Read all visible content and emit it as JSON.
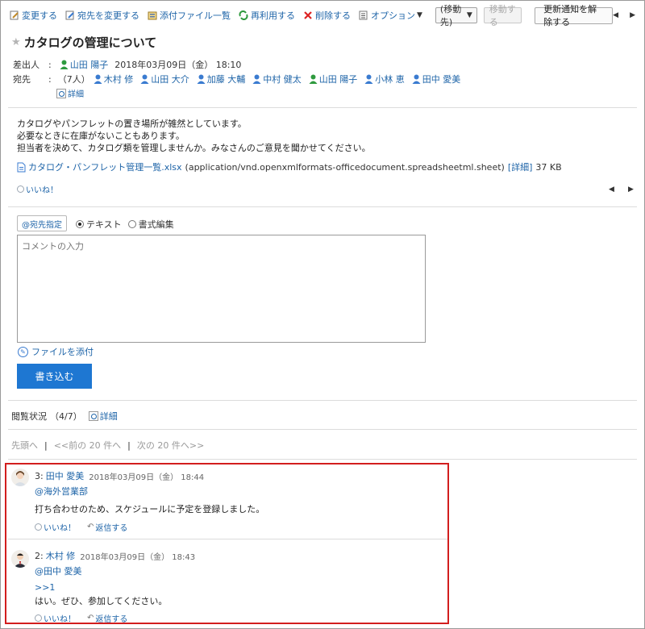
{
  "toolbar": {
    "change": "変更する",
    "change_recipients": "宛先を変更する",
    "attachments_list": "添付ファイル一覧",
    "reuse": "再利用する",
    "delete": "削除する",
    "options": "オプション",
    "move_select": "(移動先)",
    "move_button": "移動する",
    "unsubscribe": "更新通知を解除する"
  },
  "message": {
    "title": "カタログの管理について",
    "sender_label": "差出人",
    "sender_name": "山田 陽子",
    "sent_at": "2018年03月09日（金） 18:10",
    "recipients_label": "宛先",
    "recipients_count": "（7人）",
    "recipients": [
      "木村 修",
      "山田 大介",
      "加藤 大輔",
      "中村 健太",
      "山田 陽子",
      "小林 恵",
      "田中 愛美"
    ],
    "details_link": "詳細",
    "body_lines": [
      "カタログやパンフレットの置き場所が雑然としています。",
      "必要なときに在庫がないこともあります。",
      "担当者を決めて、カタログ類を管理しませんか。みなさんのご意見を聞かせてください。"
    ],
    "file_name": "カタログ・パンフレット管理一覧.xlsx",
    "file_type": "(application/vnd.openxmlformats-officedocument.spreadsheetml.sheet)",
    "file_detail": "[詳細]",
    "file_size": "37 KB",
    "like": "いいね！"
  },
  "compose": {
    "mention_button": "@宛先指定",
    "mode_text": "テキスト",
    "mode_rich": "書式編集",
    "placeholder": "コメントの入力",
    "attach": "ファイルを添付",
    "submit": "書き込む"
  },
  "read_status": {
    "label": "閲覧状況",
    "count": "（4/7）",
    "details": "詳細"
  },
  "pager": {
    "first": "先頭へ",
    "prev": "<<前の 20 件へ",
    "next": "次の 20 件へ>>"
  },
  "comments": [
    {
      "number": "3:",
      "author": "田中 愛美",
      "date": "2018年03月09日（金） 18:44",
      "mention": "@海外営業部",
      "quote": "",
      "text": "打ち合わせのため、スケジュールに予定を登録しました。",
      "like": "いいね！",
      "reply": "返信する"
    },
    {
      "number": "2:",
      "author": "木村 修",
      "date": "2018年03月09日（金） 18:43",
      "mention": "@田中 愛美",
      "quote": ">>1",
      "text": "はい。ぜひ、参加してください。",
      "like": "いいね！",
      "reply": "返信する"
    }
  ],
  "colors": {
    "link": "#1e64a8",
    "primary_button": "#1e77d2",
    "highlight_border": "#d21e1e"
  }
}
